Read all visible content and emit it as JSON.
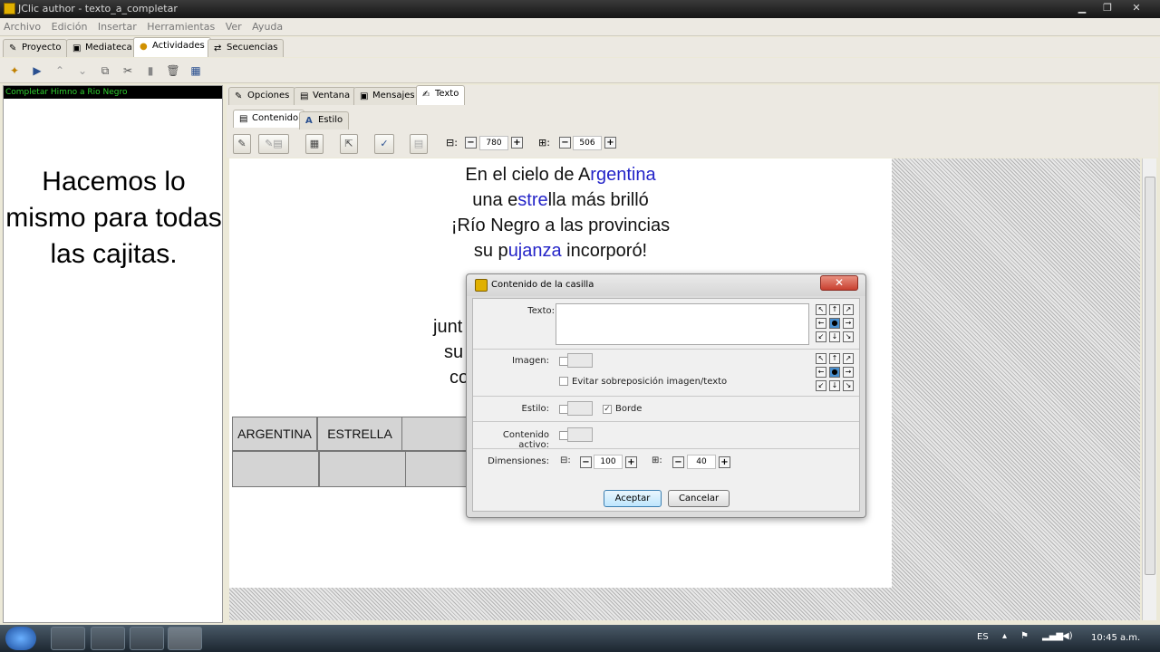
{
  "window": {
    "title": "JClic author - texto_a_completar",
    "controls": [
      "minimize-icon",
      "restore-icon",
      "close-icon"
    ]
  },
  "menu": [
    "Archivo",
    "Edición",
    "Insertar",
    "Herramientas",
    "Ver",
    "Ayuda"
  ],
  "top_tabs": [
    "Proyecto",
    "Mediateca",
    "Actividades",
    "Secuencias"
  ],
  "active_top_tab": "Actividades",
  "activity_list": {
    "selected": "Completar Himno a Rio Negro"
  },
  "overlay_caption": "Hacemos lo mismo para todas las cajitas.",
  "right_tabs": [
    "Opciones",
    "Ventana",
    "Mensajes",
    "Texto"
  ],
  "active_right_tab": "Texto",
  "sub_tabs": [
    "Contenido",
    "Estilo"
  ],
  "editor_toolbar": {
    "width": "780",
    "height": "506"
  },
  "poem": {
    "line1_a": "En el cielo de A",
    "line1_b": "rgentina",
    "line2_a": "una e",
    "line2_b": "stre",
    "line2_c": "lla más brilló",
    "line3": "¡Río Negro a las provincias",
    "line4_a": "su p",
    "line4_b": "ujanza",
    "line4_c": " incorporó!",
    "line5": "junt",
    "line6": "su",
    "line7": "co"
  },
  "answer_cells": [
    "ARGENTINA",
    "ESTRELLA"
  ],
  "dialog": {
    "title": "Contenido de la casilla",
    "texto_label": "Texto:",
    "imagen_label": "Imagen:",
    "evitar_label": "Evitar sobreposición imagen/texto",
    "estilo_label": "Estilo:",
    "borde_label": "Borde",
    "borde_checked": true,
    "contenido_activo_label": "Contenido activo:",
    "dimensiones_label": "Dimensiones:",
    "width": "100",
    "height": "40",
    "accept": "Aceptar",
    "cancel": "Cancelar"
  },
  "tray": {
    "language": "ES",
    "time": "10:45 a.m."
  },
  "colors": {
    "highlight": "#2424c8",
    "selection_text": "#2fd02f"
  }
}
